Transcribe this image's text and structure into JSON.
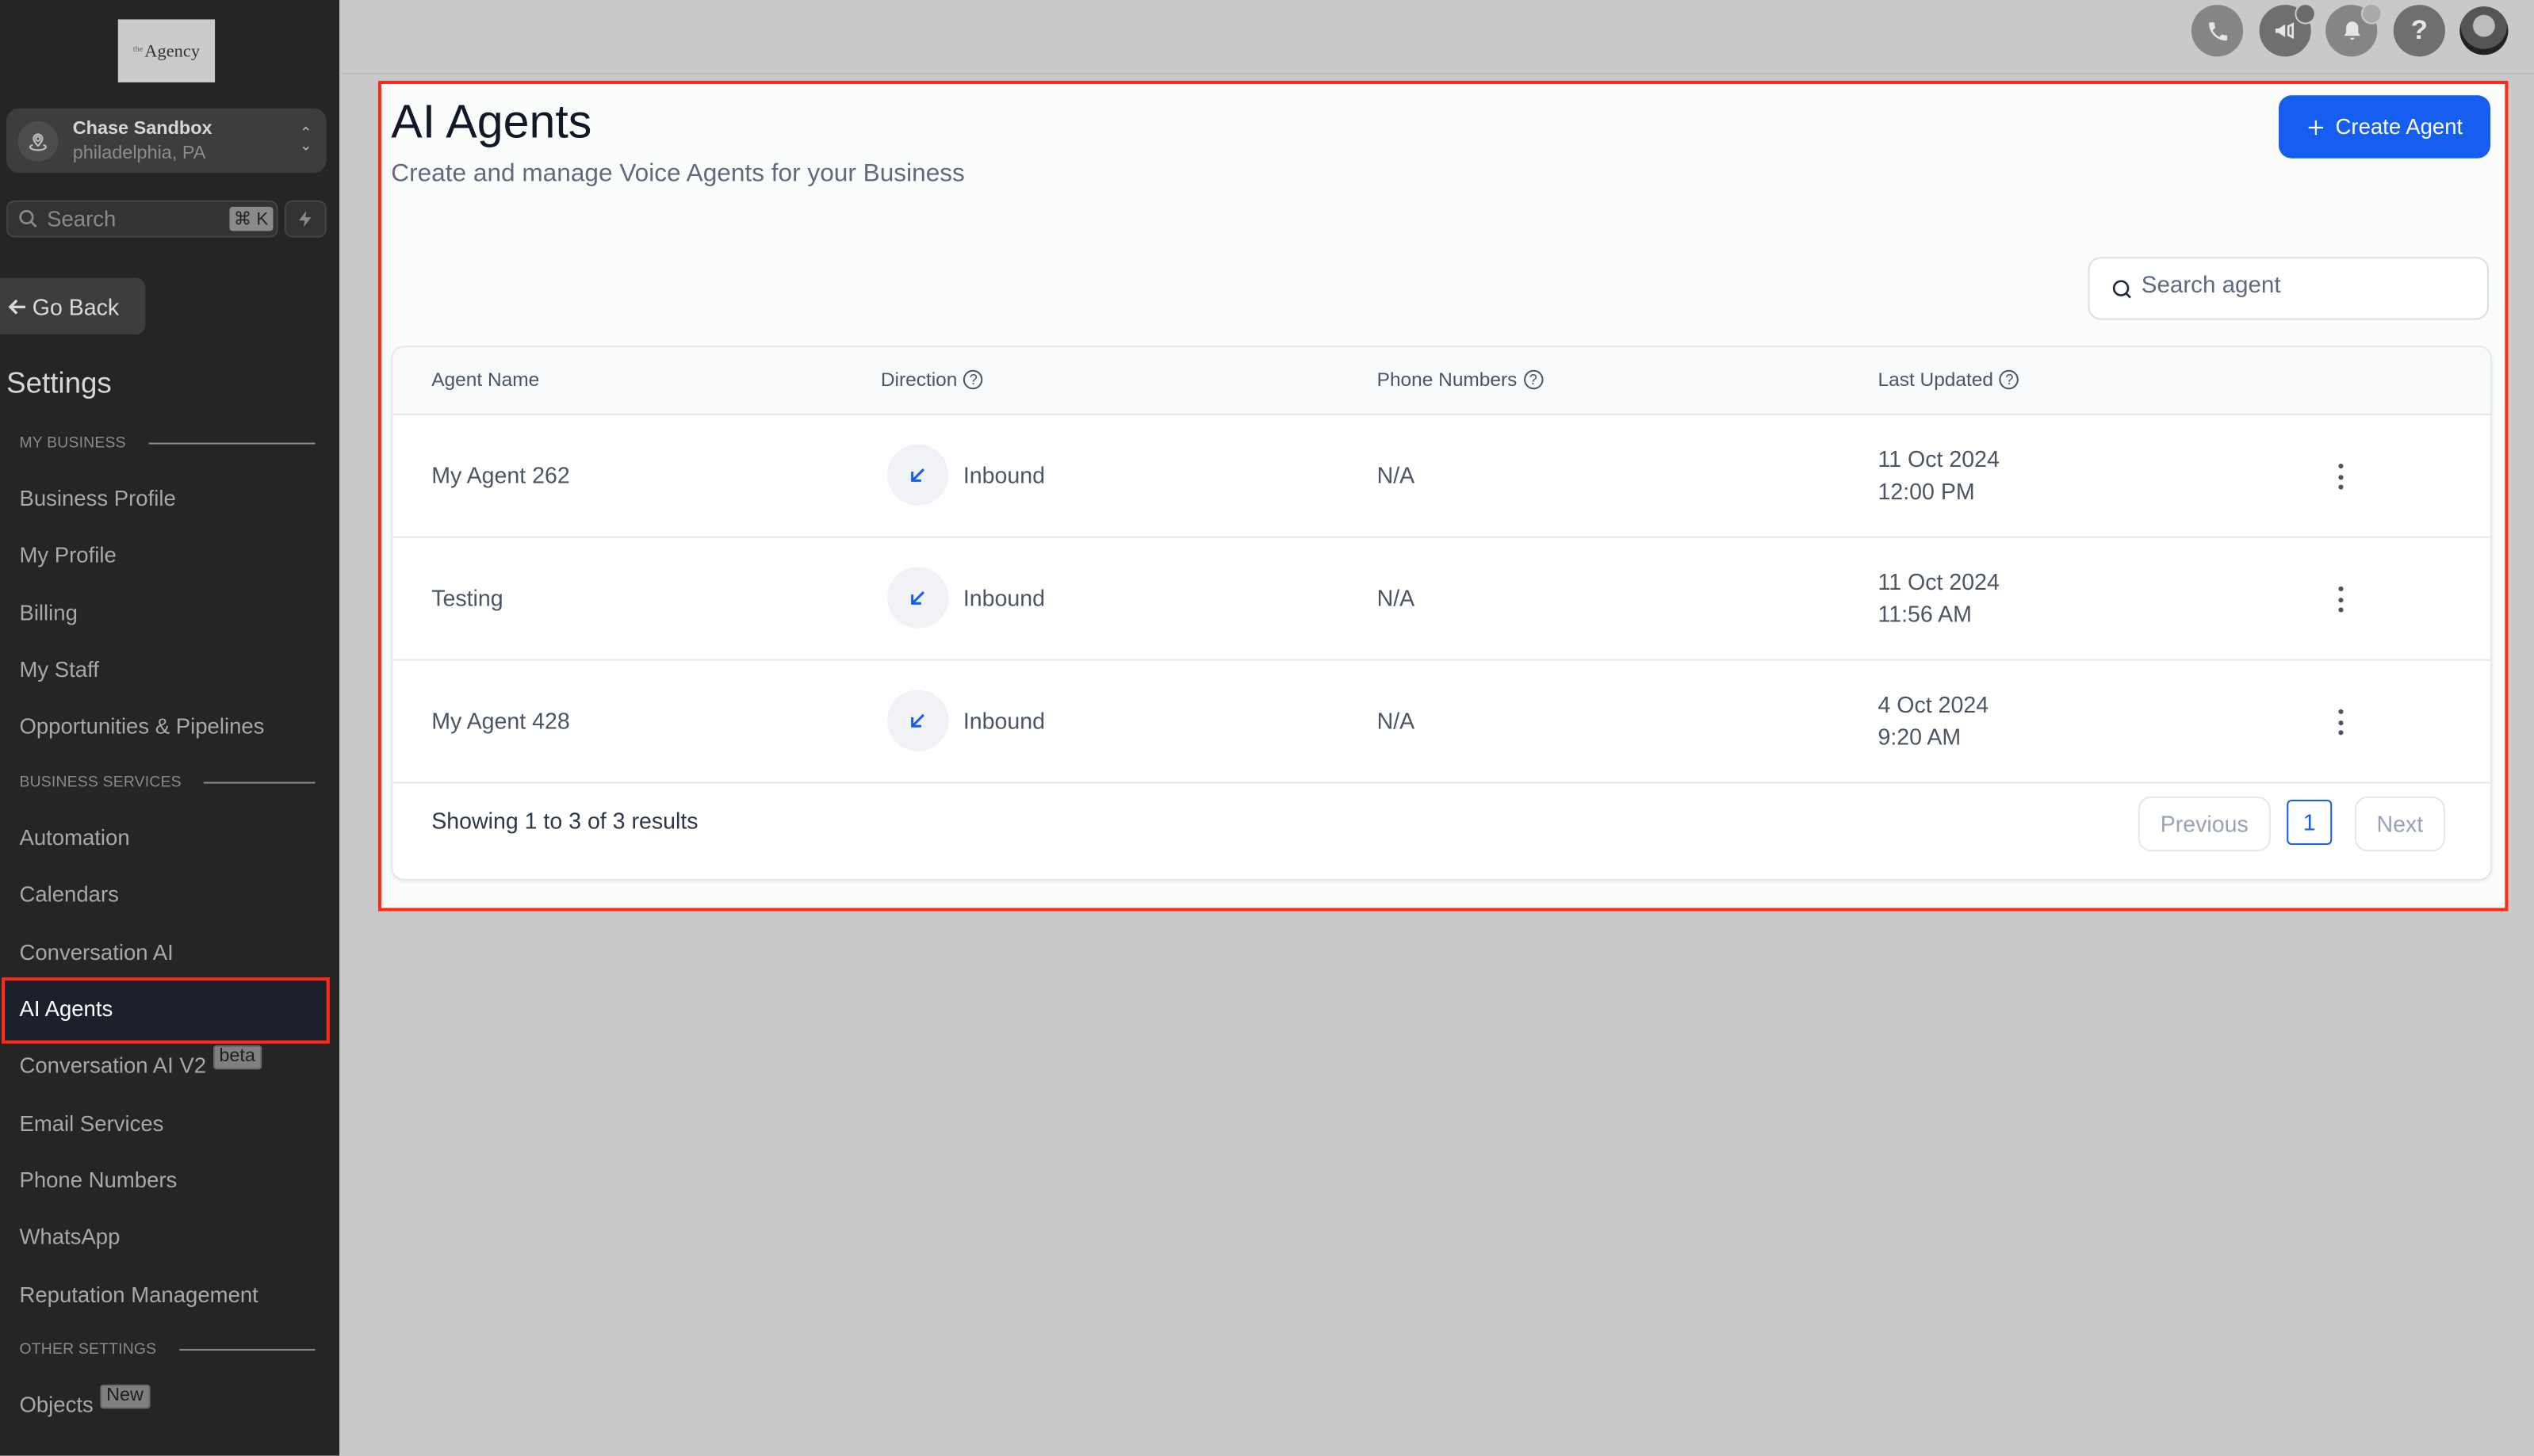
{
  "sidebar": {
    "logo": {
      "prefix": "the",
      "text": "Agency"
    },
    "account": {
      "name": "Chase Sandbox",
      "location": "philadelphia, PA"
    },
    "search": {
      "placeholder": "Search",
      "shortcut": "⌘ K"
    },
    "go_back": "Go Back",
    "title": "Settings",
    "sections": [
      {
        "label": "MY BUSINESS",
        "items": [
          "Business Profile",
          "My Profile",
          "Billing",
          "My Staff",
          "Opportunities & Pipelines"
        ]
      },
      {
        "label": "BUSINESS SERVICES",
        "items": [
          "Automation",
          "Calendars",
          "Conversation AI",
          "AI Agents",
          "Conversation AI V2",
          "Email Services",
          "Phone Numbers",
          "WhatsApp",
          "Reputation Management"
        ]
      },
      {
        "label": "OTHER SETTINGS",
        "items": [
          "Objects"
        ]
      }
    ],
    "active_item": "AI Agents",
    "badges": {
      "conversation_ai_v2": "beta",
      "objects": "New"
    }
  },
  "topbar": {
    "icons": [
      "phone-icon",
      "megaphone-icon",
      "bell-icon",
      "help-icon",
      "user-avatar"
    ]
  },
  "main": {
    "title": "AI Agents",
    "subtitle": "Create and manage Voice Agents for your Business",
    "create_button": "Create Agent",
    "search_placeholder": "Search agent",
    "table": {
      "columns": [
        "Agent Name",
        "Direction",
        "Phone Numbers",
        "Last Updated"
      ],
      "rows": [
        {
          "name": "My Agent 262",
          "direction": "Inbound",
          "phone": "N/A",
          "date": "11 Oct 2024",
          "time": "12:00 PM"
        },
        {
          "name": "Testing",
          "direction": "Inbound",
          "phone": "N/A",
          "date": "11 Oct 2024",
          "time": "11:56 AM"
        },
        {
          "name": "My Agent 428",
          "direction": "Inbound",
          "phone": "N/A",
          "date": "4 Oct 2024",
          "time": "9:20 AM"
        }
      ]
    },
    "pagination": {
      "summary": "Showing 1 to 3 of 3 results",
      "previous": "Previous",
      "current_page": "1",
      "next": "Next"
    }
  },
  "colors": {
    "accent": "#155eef",
    "highlight": "#ff2a1a",
    "sidebar_bg": "#252525"
  }
}
